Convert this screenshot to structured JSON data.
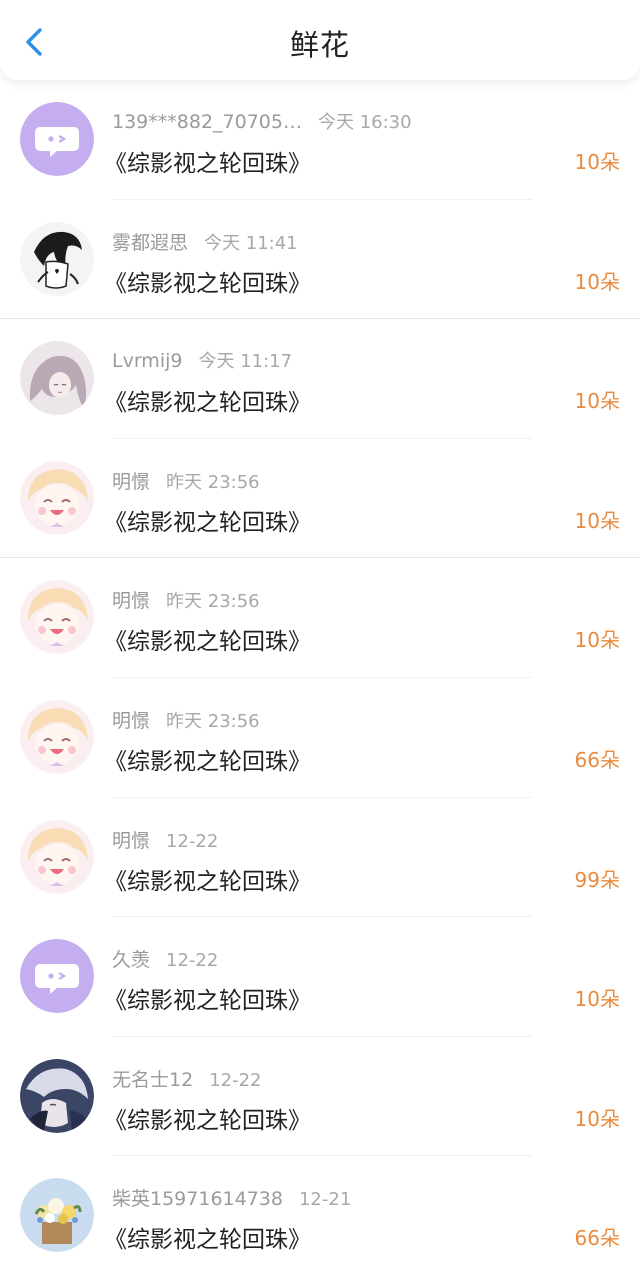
{
  "header": {
    "title": "鲜花"
  },
  "colors": {
    "accent": "#e98a3d",
    "back_arrow": "#2f8fe8",
    "default_avatar": "#c5aef0"
  },
  "rows": [
    {
      "name": "139***882_70705…",
      "time": "今天 16:30",
      "book": "《综影视之轮回珠》",
      "amount": "10朵",
      "avatar": "default-chat-avatar"
    },
    {
      "name": "雾都遐思",
      "time": "今天 11:41",
      "book": "《综影视之轮回珠》",
      "amount": "10朵",
      "avatar": "monochrome-girl-avatar"
    },
    {
      "name": "Lvrmij9",
      "time": "今天 11:17",
      "book": "《综影视之轮回珠》",
      "amount": "10朵",
      "avatar": "anime-girl-avatar"
    },
    {
      "name": "明憬",
      "time": "昨天 23:56",
      "book": "《综影视之轮回珠》",
      "amount": "10朵",
      "avatar": "laughing-anime-avatar"
    },
    {
      "name": "明憬",
      "time": "昨天 23:56",
      "book": "《综影视之轮回珠》",
      "amount": "10朵",
      "avatar": "laughing-anime-avatar"
    },
    {
      "name": "明憬",
      "time": "昨天 23:56",
      "book": "《综影视之轮回珠》",
      "amount": "66朵",
      "avatar": "laughing-anime-avatar"
    },
    {
      "name": "明憬",
      "time": "12-22",
      "book": "《综影视之轮回珠》",
      "amount": "99朵",
      "avatar": "laughing-anime-avatar"
    },
    {
      "name": "久羡",
      "time": "12-22",
      "book": "《综影视之轮回珠》",
      "amount": "10朵",
      "avatar": "default-chat-avatar"
    },
    {
      "name": "无名士12",
      "time": "12-22",
      "book": "《综影视之轮回珠》",
      "amount": "10朵",
      "avatar": "dark-anime-avatar"
    },
    {
      "name": "柴英15971614738",
      "time": "12-21",
      "book": "《综影视之轮回珠》",
      "amount": "66朵",
      "avatar": "flower-bouquet-avatar"
    }
  ]
}
